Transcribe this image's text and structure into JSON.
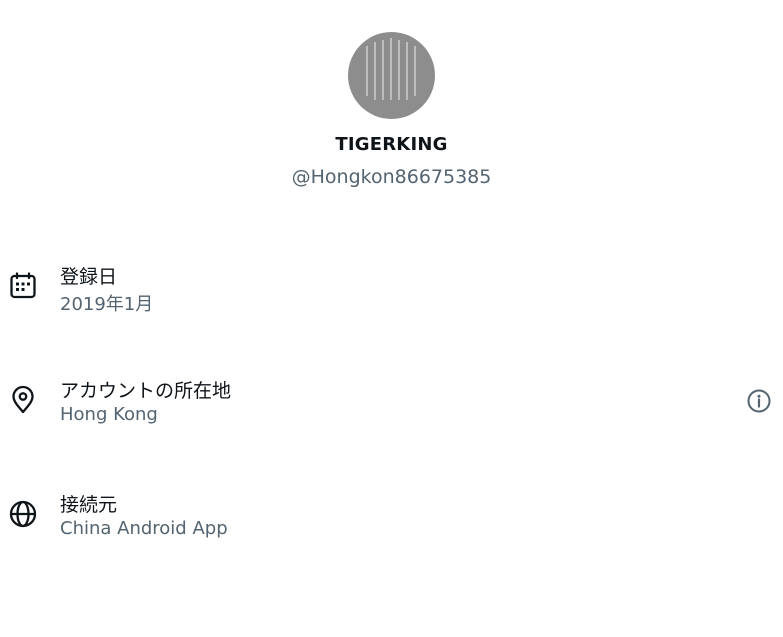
{
  "profile": {
    "display_name": "TIGERKING",
    "handle": "@Hongkon86675385"
  },
  "details": {
    "joined": {
      "icon": "calendar-icon",
      "label": "登録日",
      "value": "2019年1月"
    },
    "location": {
      "icon": "location-pin-icon",
      "label": "アカウントの所在地",
      "value": "Hong Kong",
      "info_icon": "info-circle-icon"
    },
    "connected_via": {
      "icon": "globe-icon",
      "label": "接続元",
      "value": "China Android App"
    }
  },
  "colors": {
    "primary_text": "#0f1419",
    "secondary_text": "#536471"
  }
}
